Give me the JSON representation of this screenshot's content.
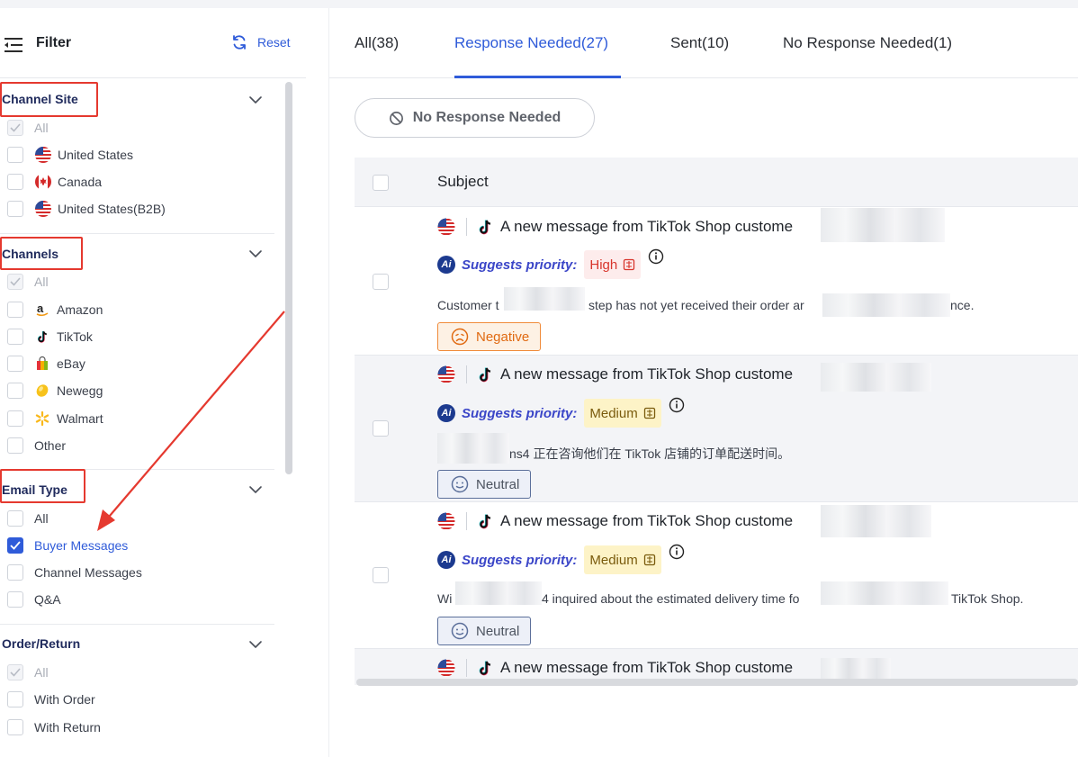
{
  "sidebar": {
    "title": "Filter",
    "reset_label": "Reset",
    "sections": {
      "channel_site": {
        "title": "Channel Site",
        "options": [
          {
            "label": "All",
            "state": "disabled-checked"
          },
          {
            "label": "United States",
            "flag": "us-flag"
          },
          {
            "label": "Canada",
            "flag": "canada-flag"
          },
          {
            "label": "United States(B2B)",
            "flag": "us-flag"
          }
        ]
      },
      "channels": {
        "title": "Channels",
        "options": [
          {
            "label": "All",
            "state": "disabled-checked"
          },
          {
            "label": "Amazon",
            "icon": "amazon-icon"
          },
          {
            "label": "TikTok",
            "icon": "tiktok-icon"
          },
          {
            "label": "eBay",
            "icon": "ebay-icon"
          },
          {
            "label": "Newegg",
            "icon": "newegg-icon"
          },
          {
            "label": "Walmart",
            "icon": "walmart-icon"
          },
          {
            "label": "Other"
          }
        ]
      },
      "email_type": {
        "title": "Email Type",
        "options": [
          {
            "label": "All"
          },
          {
            "label": "Buyer Messages",
            "state": "checked"
          },
          {
            "label": "Channel Messages"
          },
          {
            "label": "Q&A"
          }
        ]
      },
      "order_return": {
        "title": "Order/Return",
        "options": [
          {
            "label": "All",
            "state": "disabled-checked"
          },
          {
            "label": "With Order"
          },
          {
            "label": "With Return"
          }
        ]
      }
    }
  },
  "tabs": [
    {
      "label": "All(38)"
    },
    {
      "label": "Response Needed(27)",
      "active": true
    },
    {
      "label": "Sent(10)"
    },
    {
      "label": "No Response Needed(1)"
    }
  ],
  "toolbar": {
    "no_response_label": "No Response Needed"
  },
  "table": {
    "header_subject": "Subject",
    "rows": [
      {
        "subject": "A new message from TikTok Shop custome",
        "ai_label": "Ai",
        "suggests_label": "Suggests priority:",
        "priority": "High",
        "desc_a": "Customer t",
        "desc_b": "step has not yet received their order ar",
        "desc_c": "nce.",
        "sentiment": "Negative"
      },
      {
        "subject": "A new message from TikTok Shop custome",
        "ai_label": "Ai",
        "suggests_label": "Suggests priority:",
        "priority": "Medium",
        "desc_b": "ns4 正在咨询他们在 TikTok 店铺的订单配送时间。",
        "sentiment": "Neutral"
      },
      {
        "subject": "A new message from TikTok Shop custome",
        "ai_label": "Ai",
        "suggests_label": "Suggests priority:",
        "priority": "Medium",
        "desc_a": "Wi",
        "desc_b": "4 inquired about the estimated delivery time fo",
        "desc_c": "TikTok Shop.",
        "sentiment": "Neutral"
      },
      {
        "subject": "A new message from TikTok Shop custome"
      }
    ]
  },
  "colors": {
    "accent": "#2f5bd9",
    "annotation": "#e5392f",
    "high": "#d8352c",
    "negative": "#e06a12"
  }
}
